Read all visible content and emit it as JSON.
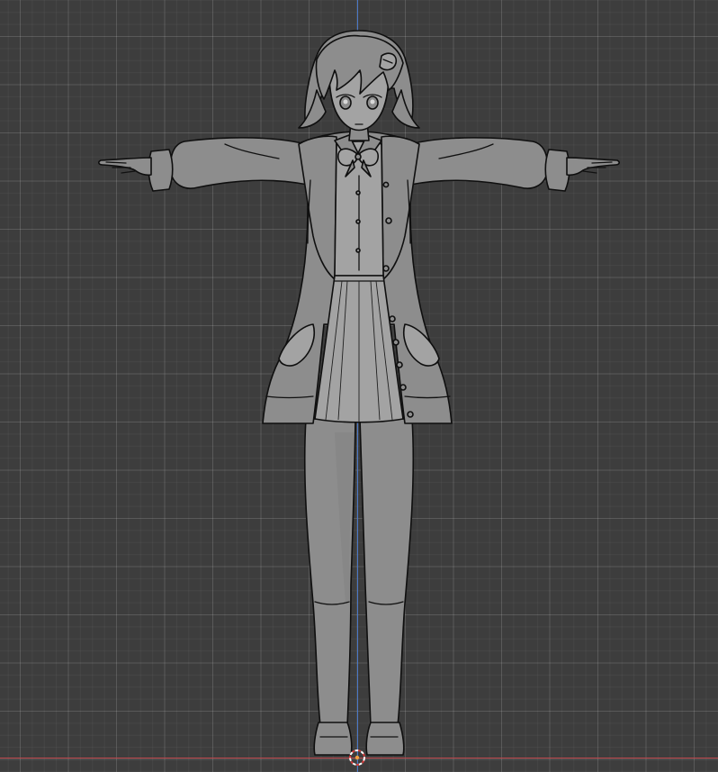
{
  "viewport": {
    "background_color": "#3d3d3d",
    "grid_line_color": "#4d4d4d",
    "axis_y_color": "#4a78c8",
    "axis_x_color": "#c0474d",
    "shading": "solid",
    "view": "front-orthographic"
  },
  "scene": {
    "object": "character-model",
    "pose": "T-pose"
  },
  "cursor": {
    "icon": "3d-cursor-icon",
    "ring_colors": [
      "#d33a3a",
      "#ffffff"
    ]
  }
}
